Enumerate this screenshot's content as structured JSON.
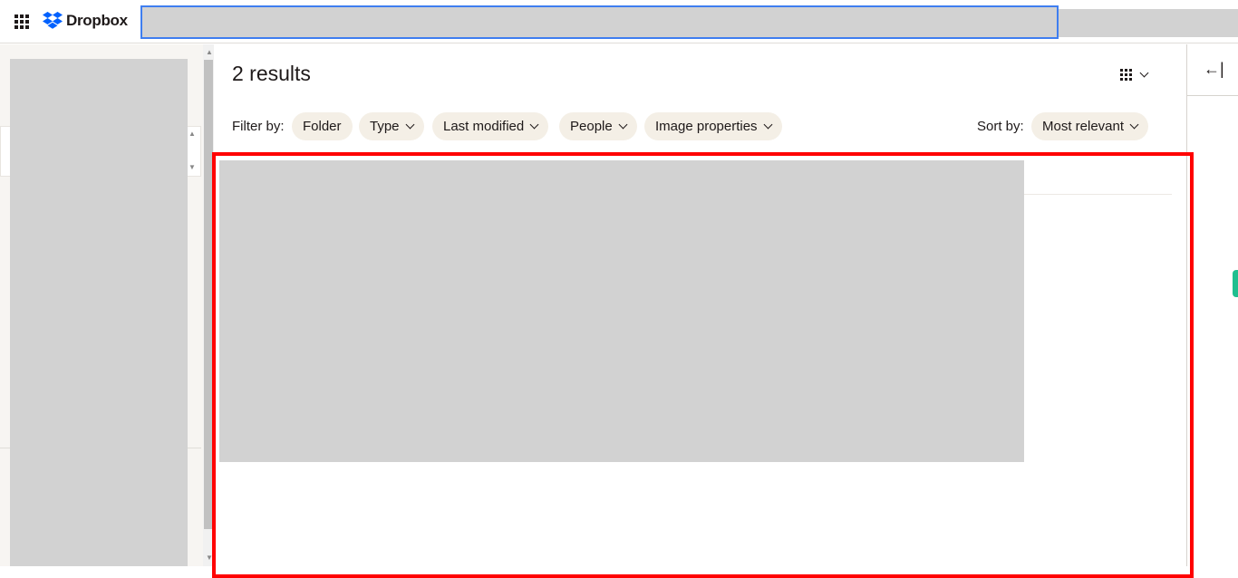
{
  "header": {
    "app_name": "Dropbox",
    "icons": {
      "apps": "app-grid-icon",
      "logo": "dropbox-logo-icon"
    },
    "brand_color": "#0061fe",
    "search_focus_color": "#3f7ef0"
  },
  "main": {
    "results_title": "2 results",
    "filter_label": "Filter by:",
    "filters": [
      {
        "label": "Folder"
      },
      {
        "label": "Type"
      },
      {
        "label": "Last modified"
      },
      {
        "label": "People"
      },
      {
        "label": "Image properties"
      }
    ],
    "sort_label": "Sort by:",
    "sort_value": "Most relevant",
    "view_icon": "grid-view-icon"
  },
  "right_panel": {
    "collapse_icon": "collapse-arrow-icon"
  },
  "colors": {
    "chip_bg": "#f4efe6",
    "highlight": "#ff0000",
    "accent_green": "#1fbf8f"
  }
}
